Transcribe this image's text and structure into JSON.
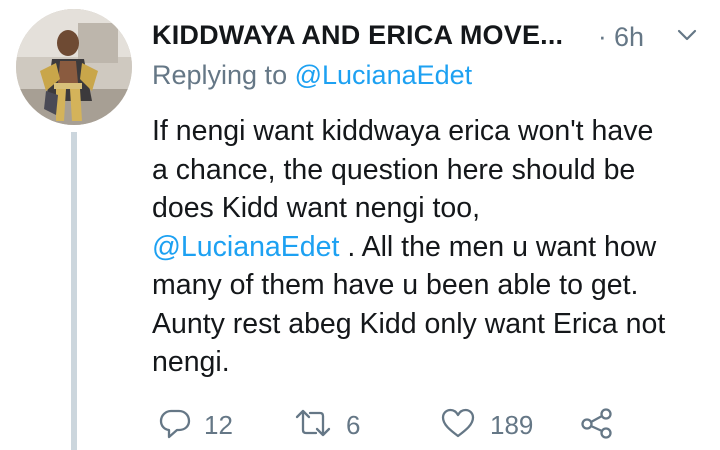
{
  "tweet": {
    "display_name": "KIDDWAYA AND ERICA MOVE...",
    "separator": "·",
    "timestamp": "6h",
    "replying_prefix": "Replying to",
    "replying_handle": "@LucianaEdet",
    "text_lines": [
      "If nengi want kiddwaya erica won't have",
      "a chance, the question here should be",
      "does Kidd want nengi too,"
    ],
    "mention": "@LucianaEdet",
    "mention_tail": " . All the men u want how",
    "text_lines_after": [
      "many of them have u been able to get.",
      "Aunty rest abeg Kidd only want Erica not",
      "nengi."
    ],
    "actions": {
      "reply": {
        "icon": "reply-icon",
        "count": "12"
      },
      "retweet": {
        "icon": "retweet-icon",
        "count": "6"
      },
      "like": {
        "icon": "heart-icon",
        "count": "189"
      },
      "share": {
        "icon": "share-icon"
      }
    }
  },
  "colors": {
    "text": "#14171a",
    "secondary": "#657786",
    "link": "#1da1f2",
    "thread_line": "#ccd6dd"
  }
}
